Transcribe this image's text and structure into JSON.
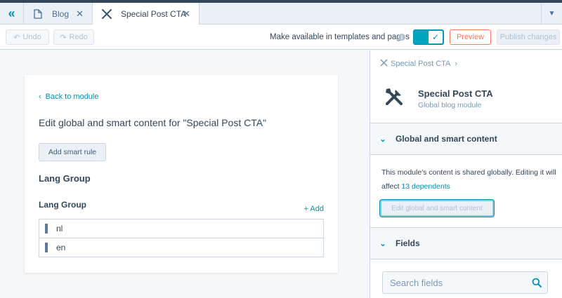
{
  "tabs": {
    "blog_label": "Blog",
    "active_label": "Special Post CTA",
    "close_glyph": "✕"
  },
  "toolbar": {
    "undo_label": "Undo",
    "redo_label": "Redo",
    "availability_label": "Make available in templates and pages",
    "preview_label": "Preview",
    "publish_label": "Publish changes"
  },
  "editor": {
    "back_label": "Back to module",
    "title": "Edit global and smart content for \"Special Post CTA\"",
    "add_smart_rule_label": "Add smart rule",
    "group_heading": "Lang Group",
    "group_label": "Lang Group",
    "add_label": "+ Add",
    "items": [
      "nl",
      "en"
    ]
  },
  "sidebar": {
    "breadcrumb": "Special Post CTA",
    "module_name": "Special Post CTA",
    "module_type": "Global blog module",
    "global_section_label": "Global and smart content",
    "global_desc_prefix": "This module's content is shared globally. Editing it will affect ",
    "dependents_link": "13 dependents",
    "edit_global_label": "Edit global and smart content",
    "fields_section_label": "Fields",
    "search_placeholder": "Search fields"
  },
  "colors": {
    "accent": "#0091ae",
    "toggle": "#00a4bd",
    "preview": "#ff7a59",
    "text": "#33475b"
  },
  "icons": {
    "collapse": "double-chevron-left-icon",
    "blog": "document-icon",
    "module": "wrench-screwdriver-icon",
    "search": "search-icon"
  }
}
